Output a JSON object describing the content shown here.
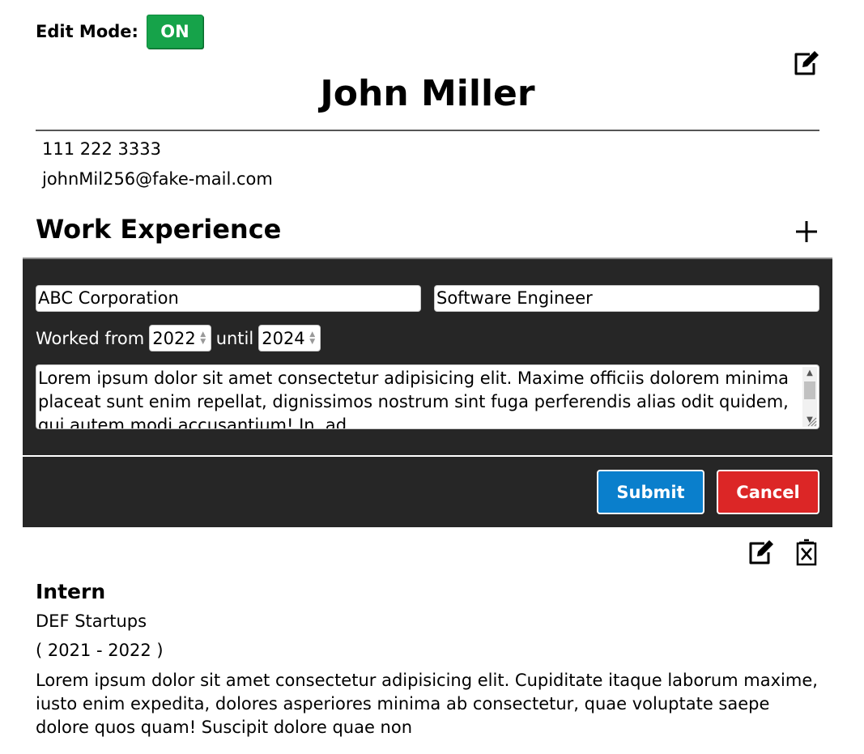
{
  "edit_mode": {
    "label": "Edit Mode:",
    "state": "ON",
    "color": "#16a34a"
  },
  "header": {
    "name": "John Miller"
  },
  "contact": {
    "phone": "111 222 3333",
    "email": "johnMil256@fake-mail.com"
  },
  "work_experience": {
    "title": "Work Experience",
    "form": {
      "company_value": "ABC Corporation",
      "position_value": "Software Engineer",
      "worked_from_label": "Worked from",
      "from_year": "2022",
      "until_label": "until",
      "until_year": "2024",
      "description": "Lorem ipsum dolor sit amet consectetur adipisicing elit. Maxime officiis dolorem minima placeat sunt enim repellat, dignissimos nostrum sint fuga perferendis alias odit quidem, qui autem modi accusantium! In, ad",
      "submit_label": "Submit",
      "cancel_label": "Cancel",
      "submit_color": "#0a7fcc",
      "cancel_color": "#dc2626",
      "panel_color": "#262626"
    },
    "entries": [
      {
        "title": "Intern",
        "company": "DEF Startups",
        "dates": "( 2021 - 2022 )",
        "description": "Lorem ipsum dolor sit amet consectetur adipisicing elit. Cupiditate itaque laborum maxime, iusto enim expedita, dolores asperiores minima ab consectetur, quae voluptate saepe dolore quos quam! Suscipit dolore quae non"
      }
    ]
  },
  "icons": {
    "edit": "edit-icon",
    "add": "plus-icon",
    "delete": "delete-icon"
  }
}
